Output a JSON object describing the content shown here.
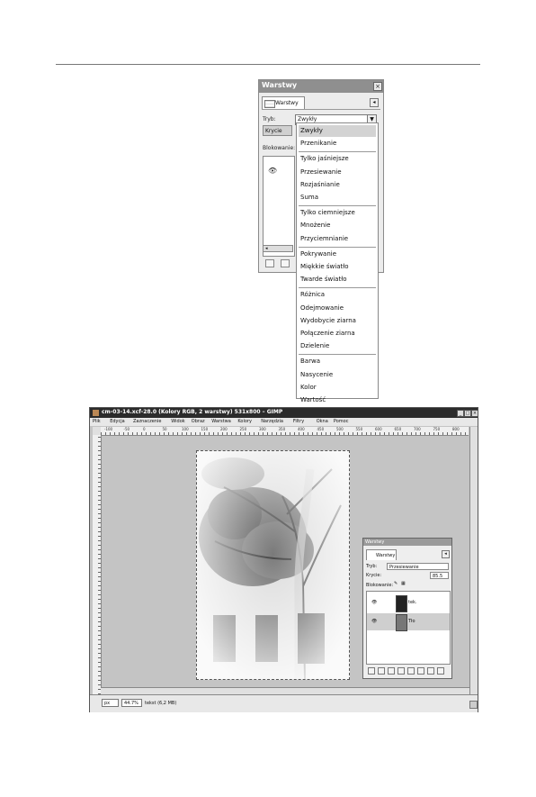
{
  "layers_dialog": {
    "title": "Warstwy",
    "tab_label": "Warstwy",
    "mode_label": "Tryb:",
    "mode_value": "Zwykły",
    "opacity_label": "Krycie",
    "lock_label": "Blokowanie:",
    "menu_items": [
      [
        "Zwykły",
        "Przenikanie"
      ],
      [
        "Tylko jaśniejsze",
        "Przesiewanie",
        "Rozjaśnianie",
        "Suma"
      ],
      [
        "Tylko ciemniejsze",
        "Mnożenie",
        "Przyciemnianie"
      ],
      [
        "Pokrywanie",
        "Miękkie światło",
        "Twarde światło"
      ],
      [
        "Różnica",
        "Odejmowanie",
        "Wydobycie ziarna",
        "Połączenie ziarna",
        "Dzielenie"
      ],
      [
        "Barwa",
        "Nasycenie",
        "Kolor",
        "Wartość"
      ]
    ],
    "selected_item": "Zwykły"
  },
  "gimp_window": {
    "title": "cm-03-14.xcf-28.0 (Kolory RGB, 2 warstwy) 531x800 – GIMP",
    "menus": [
      "Plik",
      "Edycja",
      "Zaznaczenie",
      "Widok",
      "Obraz",
      "Warstwa",
      "Kolory",
      "Narzędzia",
      "Filtry",
      "Okna",
      "Pomoc"
    ],
    "ruler_ticks": [
      "-100",
      "-50",
      "0",
      "50",
      "100",
      "150",
      "200",
      "250",
      "300",
      "350",
      "400",
      "450",
      "500",
      "550",
      "600",
      "650",
      "700",
      "750",
      "800"
    ],
    "status": {
      "unit": "px",
      "zoom": "44.7%",
      "info": "tekst (6,2 MB)"
    },
    "small_dialog": {
      "title": "Warstwy",
      "tab_label": "Warstwy",
      "mode_label": "Tryb:",
      "mode_value": "Przesiewanie",
      "opacity_label": "Krycie:",
      "opacity_value": "85.5",
      "lock_label": "Blokowanie:",
      "layers": [
        {
          "name": "tek."
        },
        {
          "name": "Tło"
        }
      ]
    }
  }
}
